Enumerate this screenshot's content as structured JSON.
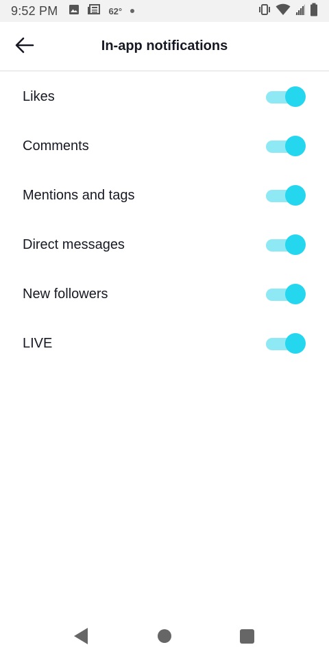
{
  "status_bar": {
    "time": "9:52 PM",
    "temperature": "62°",
    "icons_left": [
      "photo-icon",
      "news-icon",
      "temperature",
      "dot-icon"
    ],
    "icons_right": [
      "vibrate-icon",
      "wifi-icon",
      "signal-icon",
      "battery-icon"
    ]
  },
  "header": {
    "title": "In-app notifications",
    "back_icon": "arrow-left-icon"
  },
  "settings": [
    {
      "label": "Likes",
      "enabled": true
    },
    {
      "label": "Comments",
      "enabled": true
    },
    {
      "label": "Mentions and tags",
      "enabled": true
    },
    {
      "label": "Direct messages",
      "enabled": true
    },
    {
      "label": "New followers",
      "enabled": true
    },
    {
      "label": "LIVE",
      "enabled": true
    }
  ],
  "colors": {
    "toggle_thumb": "#25d6ef",
    "toggle_track": "#8fe9f5",
    "text": "#161823"
  },
  "nav_bar": {
    "buttons": [
      "back-triangle-icon",
      "home-circle-icon",
      "recents-square-icon"
    ]
  }
}
